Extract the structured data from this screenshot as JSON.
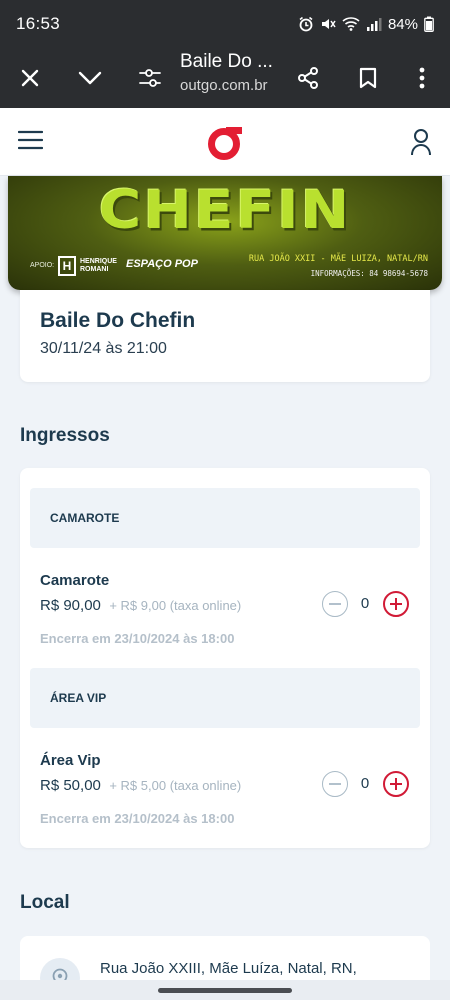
{
  "status_bar": {
    "time": "16:53",
    "battery": "84%",
    "icons": [
      "alarm-icon",
      "mute-icon",
      "wifi-icon",
      "signal-icon",
      "battery-icon"
    ]
  },
  "browser": {
    "title": "Baile Do ...",
    "url": "outgo.com.br",
    "icons": [
      "close-icon",
      "chevron-down-icon",
      "page-settings-icon",
      "share-icon",
      "bookmark-icon",
      "more-vertical-icon"
    ]
  },
  "site": {
    "icons": [
      "menu-icon",
      "outgo-logo",
      "user-icon"
    ],
    "brand_color": "#e31e33"
  },
  "banner": {
    "title": "CHEFIN",
    "apoio": "APOIO:",
    "sponsor1_mark": "H",
    "sponsor1_name": "HENRIQUE ROMANI",
    "sponsor2_name": "ESPAÇO POP",
    "address": "RUA JOÃO XXII - MÃE LUIZA, NATAL/RN",
    "info": "INFORMAÇÕES: 84 98694-5678"
  },
  "event": {
    "name": "Baile Do Chefin",
    "date": "30/11/24 às 21:00"
  },
  "tickets": {
    "section_title": "Ingressos",
    "categories": [
      {
        "header": "CAMAROTE",
        "ticket_name": "Camarote",
        "price": "R$ 90,00",
        "fee": "+ R$ 9,00 (taxa online)",
        "deadline": "Encerra em 23/10/2024 às 18:00",
        "quantity": "0"
      },
      {
        "header": "ÁREA VIP",
        "ticket_name": "Área Vip",
        "price": "R$ 50,00",
        "fee": "+ R$ 5,00 (taxa online)",
        "deadline": "Encerra em 23/10/2024 às 18:00",
        "quantity": "0"
      }
    ]
  },
  "local": {
    "section_title": "Local",
    "address": "Rua João XXIII, Mãe Luíza, Natal, RN,",
    "icon": "location-pin-icon"
  }
}
